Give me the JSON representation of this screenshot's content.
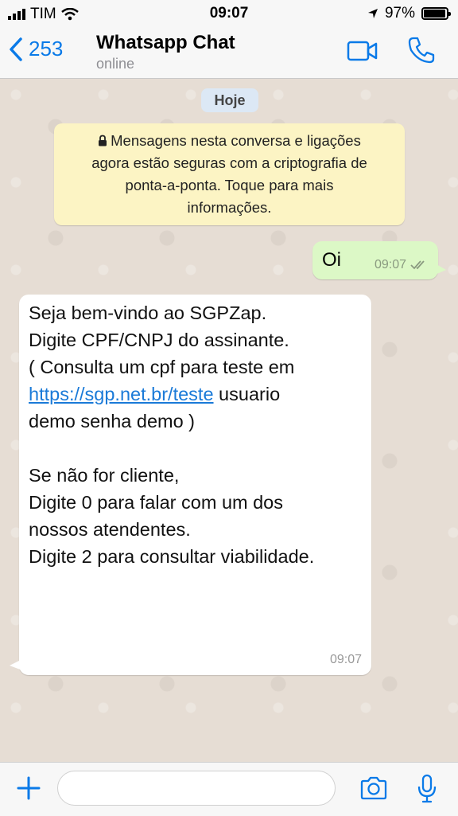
{
  "status_bar": {
    "carrier": "TIM",
    "time": "09:07",
    "battery": "97%",
    "battery_level": 0.97
  },
  "header": {
    "back_count": "253",
    "title": "Whatsapp Chat",
    "subtitle": "online",
    "icons": [
      "chevron-left-icon",
      "video-camera-icon",
      "phone-icon"
    ]
  },
  "chat": {
    "date_label": "Hoje",
    "system_message": {
      "lines": [
        "Mensagens nesta conversa e ligações",
        "agora estão seguras com a criptografia de",
        "ponta-a-ponta. Toque para mais",
        "informações."
      ]
    },
    "outgoing": {
      "text": "Oi",
      "time": "09:07"
    },
    "incoming": {
      "line1": "Seja bem-vindo ao SGPZap.",
      "line2": "Digite CPF/CNPJ do assinante.",
      "line3": "( Consulta um cpf para teste em",
      "link": "https://sgp.net.br/teste",
      "line4_rest": " usuario",
      "line5": "demo senha demo )",
      "line6": "Se não for cliente,",
      "line7": "Digite 0 para falar com um dos",
      "line8": "nossos atendentes.",
      "line9": "Digite 2 para consultar viabilidade.",
      "time": "09:07"
    }
  },
  "input_bar": {
    "placeholder": "",
    "icons": [
      "plus-icon",
      "camera-icon",
      "microphone-icon"
    ]
  },
  "colors": {
    "accent": "#0a7ae8",
    "outgoing_bubble": "#dcf8c6",
    "system_bubble": "#fcf4c4",
    "date_pill": "#dce8f5",
    "chat_background": "#e6ddd4"
  }
}
